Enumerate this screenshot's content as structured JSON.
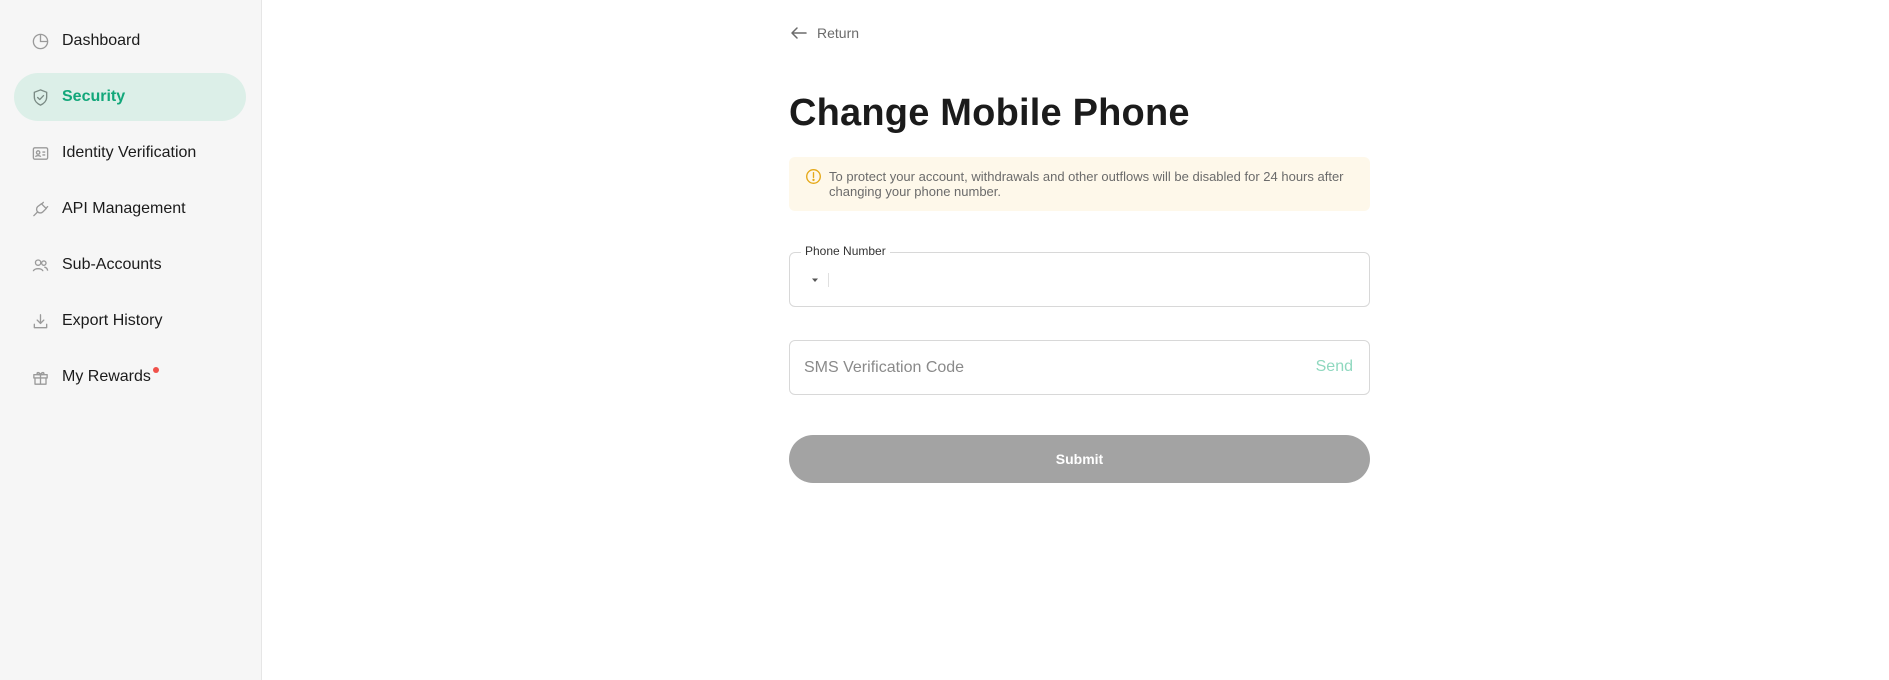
{
  "sidebar": {
    "items": [
      {
        "label": "Dashboard",
        "icon": "pie-chart-icon",
        "active": false
      },
      {
        "label": "Security",
        "icon": "shield-icon",
        "active": true
      },
      {
        "label": "Identity Verification",
        "icon": "id-card-icon",
        "active": false
      },
      {
        "label": "API Management",
        "icon": "plug-icon",
        "active": false
      },
      {
        "label": "Sub-Accounts",
        "icon": "users-icon",
        "active": false
      },
      {
        "label": "Export History",
        "icon": "download-icon",
        "active": false
      },
      {
        "label": "My Rewards",
        "icon": "gift-icon",
        "active": false,
        "has_notification_dot": true
      }
    ]
  },
  "main": {
    "return_label": "Return",
    "title": "Change Mobile Phone",
    "alert": {
      "icon": "info-icon",
      "text": "To protect your account, withdrawals and other outflows will be disabled for 24 hours after changing your phone number."
    },
    "phone_field": {
      "label": "Phone Number",
      "value": ""
    },
    "sms_field": {
      "placeholder": "SMS Verification Code",
      "value": "",
      "send_label": "Send"
    },
    "submit_label": "Submit"
  },
  "colors": {
    "accent": "#12a77a",
    "active_bg": "#dcefe8",
    "alert_bg": "#fef8ea",
    "alert_icon": "#e5a91a",
    "notification_dot": "#f0514a",
    "submit_disabled": "#a3a3a3",
    "send_disabled": "#8fd8bf"
  }
}
